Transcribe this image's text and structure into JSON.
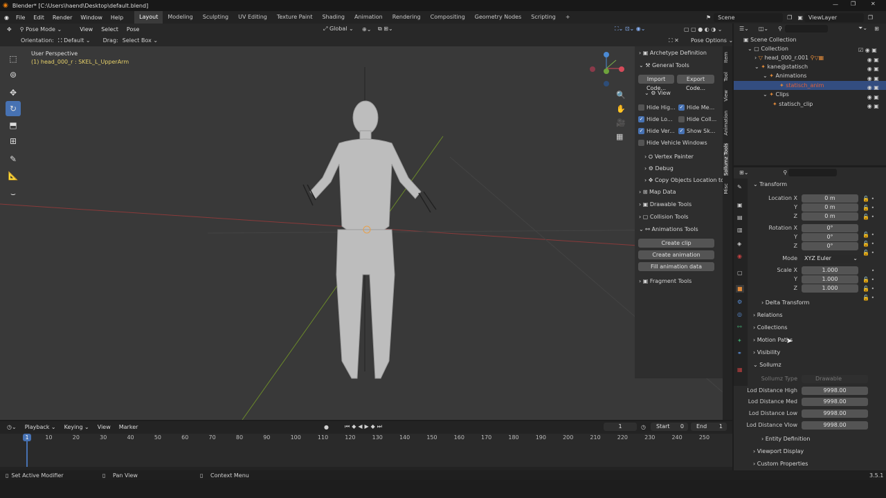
{
  "title": "Blender* [C:\\Users\\haend\\Desktop\\default.blend]",
  "menu": [
    "File",
    "Edit",
    "Render",
    "Window",
    "Help"
  ],
  "workspaces": [
    "Layout",
    "Modeling",
    "Sculpting",
    "UV Editing",
    "Texture Paint",
    "Shading",
    "Animation",
    "Rendering",
    "Compositing",
    "Geometry Nodes",
    "Scripting",
    "+"
  ],
  "scene": "Scene",
  "viewlayer": "ViewLayer",
  "header3d": {
    "mode": "Pose Mode",
    "view": "View",
    "select": "Select",
    "pose": "Pose",
    "orientation_menu": "Global",
    "pose_options": "Pose Options"
  },
  "toolsettings": {
    "orientation_label": "Orientation:",
    "orientation_value": "Default",
    "drag_label": "Drag:",
    "drag_value": "Select Box"
  },
  "viewport": {
    "persp": "User Perspective",
    "active": "(1) head_000_r : SKEL_L_UpperArm"
  },
  "npanel": {
    "archetype": "Archetype Definition",
    "general": "General Tools",
    "import": "Import Code...",
    "export": "Export Code...",
    "view": "View",
    "hide_hig": "Hide Hig...",
    "hide_me": "Hide Me...",
    "hide_lo": "Hide Lo...",
    "hide_coll": "Hide Coll...",
    "hide_ver": "Hide Ver...",
    "show_sk": "Show Sk...",
    "hide_vehicle": "Hide Vehicle Windows",
    "vertex_painter": "Vertex Painter",
    "debug": "Debug",
    "copy_loc": "Copy Objects Location to",
    "map_data": "Map Data",
    "drawable": "Drawable Tools",
    "collision": "Collision Tools",
    "anim_tools": "Animations Tools",
    "create_clip": "Create clip",
    "create_anim": "Create animation",
    "fill_anim": "Fill animation data",
    "fragment": "Fragment Tools"
  },
  "ntabs": [
    "Item",
    "Tool",
    "View",
    "Animation",
    "Sollumz Tools",
    "Misc"
  ],
  "outliner": {
    "scene_coll": "Scene Collection",
    "coll": "Collection",
    "head": "head_000_r.001",
    "kane": "kane@statisch",
    "anims": "Animations",
    "anim": "statisch_anim",
    "clips": "Clips",
    "clip": "statisch_clip"
  },
  "props": {
    "transform": "Transform",
    "loc_x": "Location X",
    "y": "Y",
    "z": "Z",
    "loc_vals": [
      "0 m",
      "0 m",
      "0 m"
    ],
    "rot_x": "Rotation X",
    "rot_vals": [
      "0°",
      "0°",
      "0°"
    ],
    "mode_label": "Mode",
    "mode_val": "XYZ Euler",
    "scale_x": "Scale X",
    "scale_vals": [
      "1.000",
      "1.000",
      "1.000"
    ],
    "delta": "Delta Transform",
    "relations": "Relations",
    "collections": "Collections",
    "motion": "Motion Paths",
    "visibility": "Visibility",
    "sollumz": "Sollumz",
    "sollumz_type_label": "Sollumz Type",
    "sollumz_type": "Drawable",
    "lod_high": "Lod Distance High",
    "lod_med": "Lod Distance Med",
    "lod_low": "Lod Distance Low",
    "lod_vlow": "Lod Distance Vlow",
    "lod_val": "9998.00",
    "entity": "Entity Definition",
    "viewport_display": "Viewport Display",
    "custom": "Custom Properties"
  },
  "timeline": {
    "playback": "Playback",
    "keying": "Keying",
    "view": "View",
    "marker": "Marker",
    "frame": "1",
    "start_label": "Start",
    "start": "0",
    "end_label": "End",
    "end": "1",
    "ticks": [
      "1",
      "10",
      "20",
      "30",
      "40",
      "50",
      "60",
      "70",
      "80",
      "90",
      "100",
      "110",
      "120",
      "130",
      "140",
      "150",
      "160",
      "170",
      "180",
      "190",
      "200",
      "210",
      "220",
      "230",
      "240",
      "250"
    ]
  },
  "status": {
    "a": "Set Active Modifier",
    "b": "Pan View",
    "c": "Context Menu",
    "version": "3.5.1"
  },
  "colors": {
    "accent": "#4772b3",
    "selected_row": "#334d80",
    "anim_text": "#e0603a"
  }
}
